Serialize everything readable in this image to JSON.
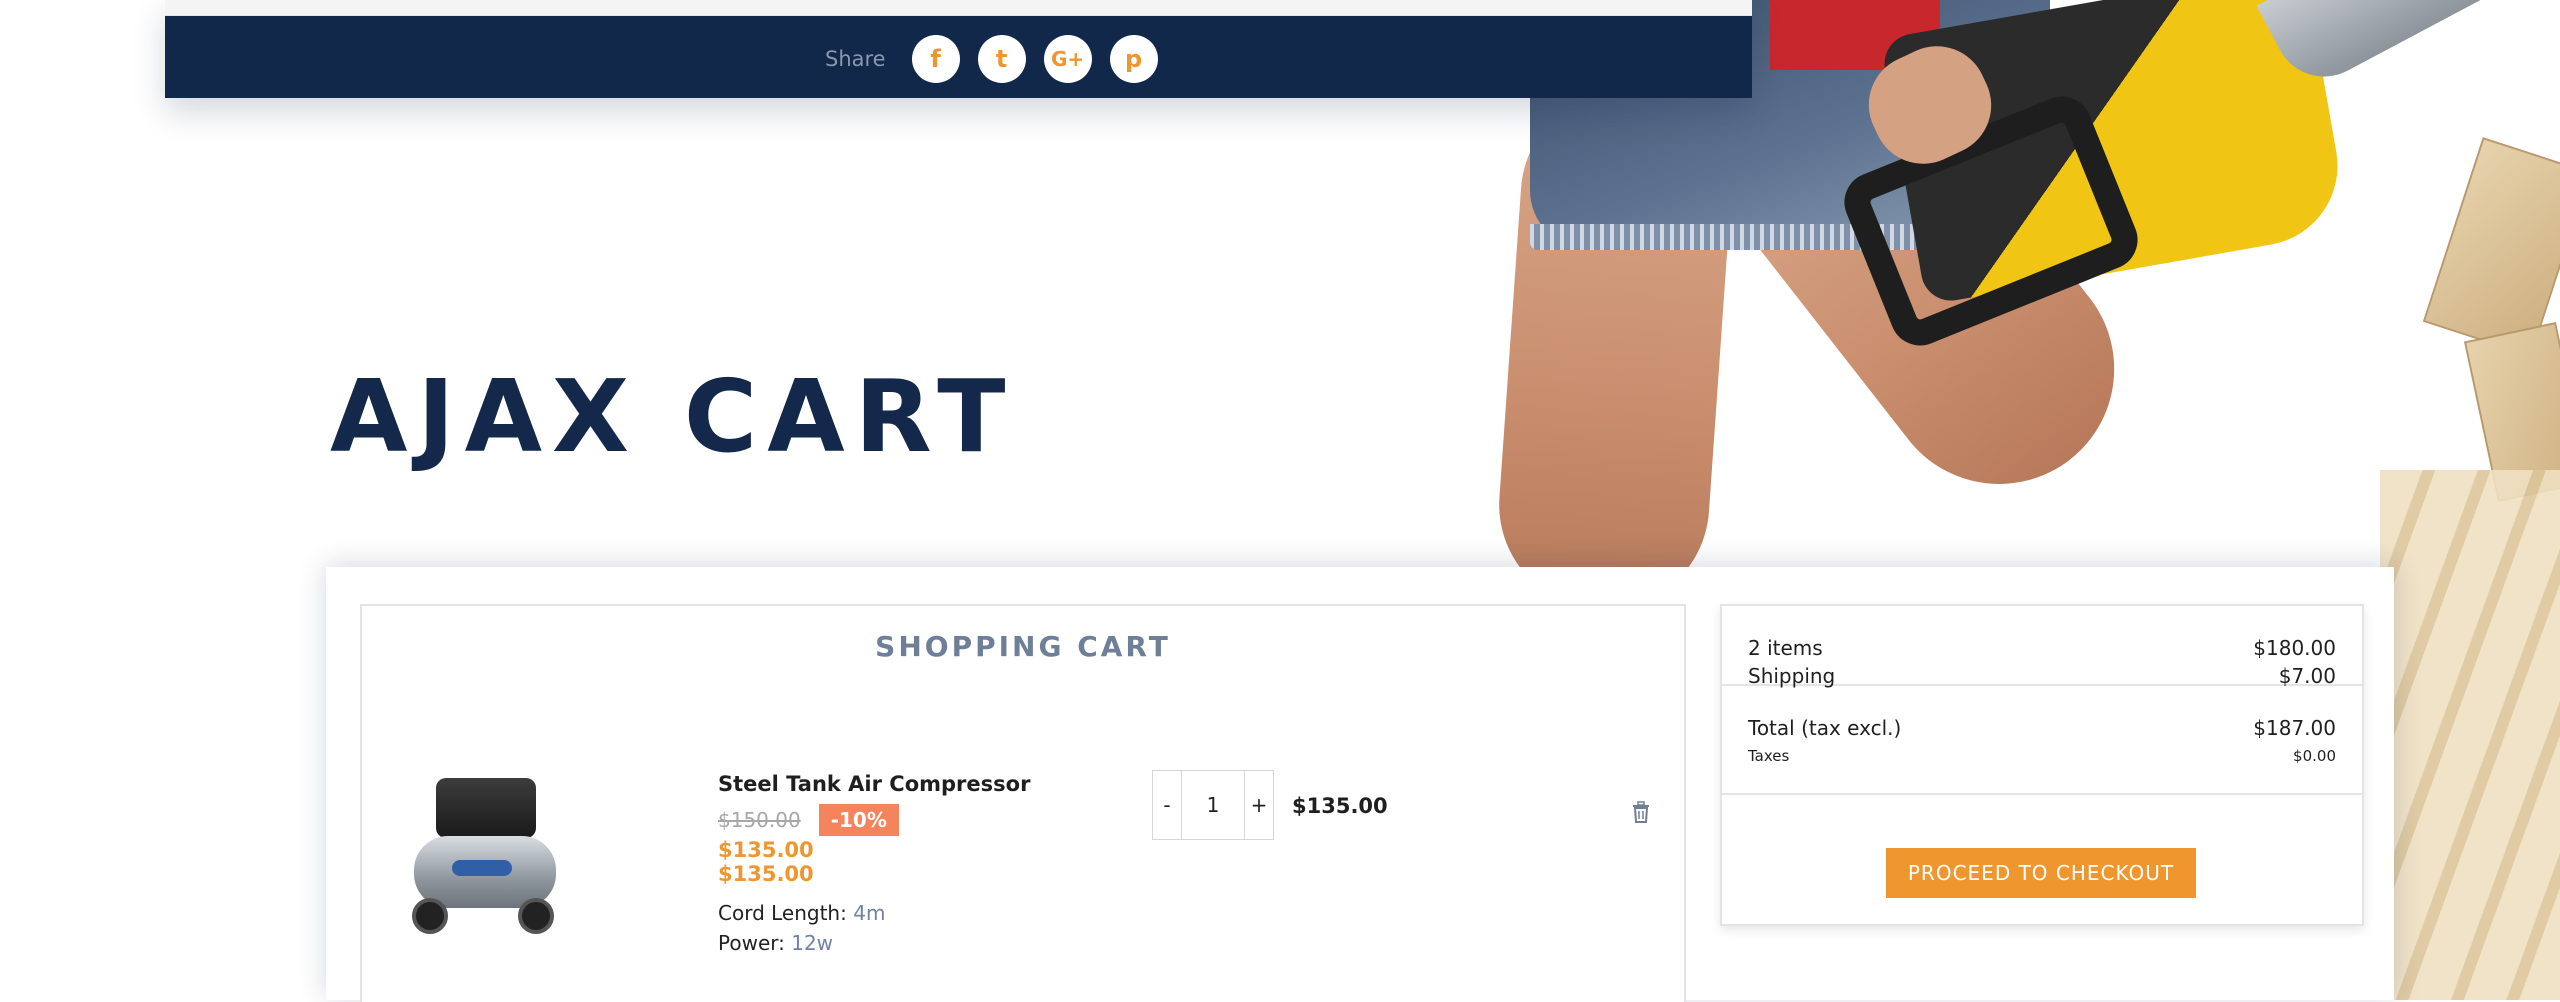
{
  "share": {
    "label": "Share",
    "icons": [
      "facebook-icon",
      "twitter-icon",
      "google-plus-icon",
      "pinterest-icon"
    ],
    "glyphs": [
      "f",
      "t",
      "G+",
      "p"
    ],
    "icon_color": "#f0962f",
    "bar_color": "#12284b"
  },
  "page": {
    "title": "AJAX CART"
  },
  "cart": {
    "heading": "SHOPPING CART",
    "item": {
      "name": "Steel Tank Air Compressor",
      "old_price": "$150.00",
      "discount": "-10%",
      "price": "$135.00",
      "unit_price": "$135.00",
      "attributes": [
        {
          "label": "Cord Length:",
          "value": "4m"
        },
        {
          "label": "Power:",
          "value": "12w"
        }
      ],
      "quantity": "1",
      "decrement": "-",
      "increment": "+",
      "line_total": "$135.00"
    }
  },
  "summary": {
    "items_label": "2 items",
    "items_value": "$180.00",
    "shipping_label": "Shipping",
    "shipping_value": "$7.00",
    "total_label": "Total (tax excl.)",
    "total_value": "$187.00",
    "taxes_label": "Taxes",
    "taxes_value": "$0.00",
    "checkout_label": "PROCEED TO CHECKOUT"
  },
  "colors": {
    "accent": "#f0962f",
    "navy": "#13284a",
    "discount": "#f3845c"
  }
}
